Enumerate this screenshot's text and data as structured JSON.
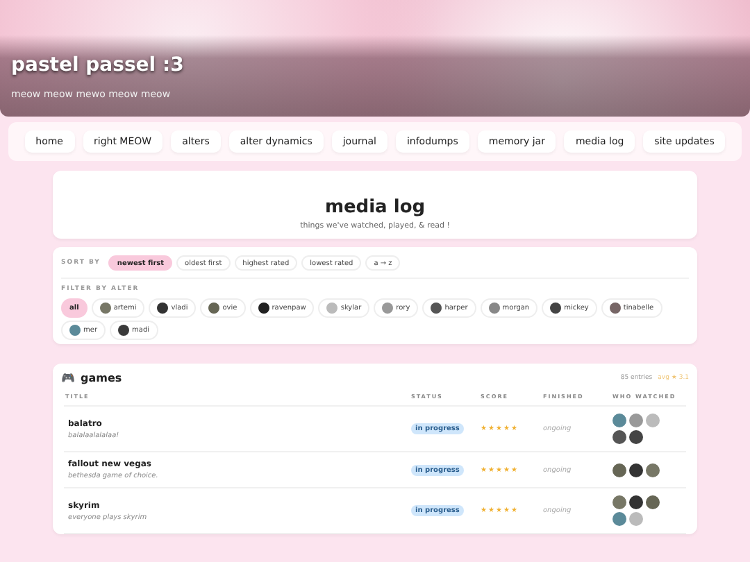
{
  "header": {
    "title": "pastel passel :3",
    "subtitle": "meow meow mewo meow meow"
  },
  "nav": [
    {
      "label": "home",
      "selected": false
    },
    {
      "label": "right MEOW",
      "selected": false
    },
    {
      "label": "alters",
      "selected": false
    },
    {
      "label": "alter dynamics",
      "selected": false
    },
    {
      "label": "journal",
      "selected": false
    },
    {
      "label": "infodumps",
      "selected": false
    },
    {
      "label": "memory jar",
      "selected": false
    },
    {
      "label": "media log",
      "selected": false
    },
    {
      "label": "site updates",
      "selected": false
    }
  ],
  "page": {
    "title": "media log",
    "subtitle": "things we've watched, played, & read !"
  },
  "sort": {
    "label": "SORT BY",
    "options": [
      {
        "label": "newest first",
        "selected": true
      },
      {
        "label": "oldest first",
        "selected": false
      },
      {
        "label": "highest rated",
        "selected": false
      },
      {
        "label": "lowest rated",
        "selected": false
      },
      {
        "label": "a → z",
        "selected": false
      }
    ]
  },
  "filter": {
    "label": "FILTER BY ALTER",
    "options": [
      {
        "label": "all",
        "selected": true,
        "kind": "plain"
      },
      {
        "label": "artemi",
        "selected": false,
        "kind": "avatar",
        "color": "#777766"
      },
      {
        "label": "vladi",
        "selected": false,
        "kind": "avatar",
        "color": "#333333"
      },
      {
        "label": "ovie",
        "selected": false,
        "kind": "avatar",
        "color": "#666655"
      },
      {
        "label": "ravenpaw",
        "selected": false,
        "kind": "avatar",
        "color": "#222222"
      },
      {
        "label": "skylar",
        "selected": false,
        "kind": "avatar",
        "color": "#bbbbbb"
      },
      {
        "label": "rory",
        "selected": false,
        "kind": "avatar",
        "color": "#999999"
      },
      {
        "label": "harper",
        "selected": false,
        "kind": "avatar",
        "color": "#555555"
      },
      {
        "label": "morgan",
        "selected": false,
        "kind": "avatar",
        "color": "#888888"
      },
      {
        "label": "mickey",
        "selected": false,
        "kind": "avatar",
        "color": "#444444"
      },
      {
        "label": "tinabelle",
        "selected": false,
        "kind": "avatar",
        "color": "#776666"
      },
      {
        "label": "mer",
        "selected": false,
        "kind": "avatar",
        "color": "#5b8a99"
      },
      {
        "label": "madi",
        "selected": false,
        "kind": "avatar",
        "color": "#3a3a3a"
      }
    ]
  },
  "section": {
    "icon": "🎮",
    "title": "games",
    "count": "85 entries",
    "average": "avg ★ 3.1",
    "columns": [
      "TITLE",
      "STATUS",
      "SCORE",
      "FINISHED",
      "WHO WATCHED"
    ],
    "rows": [
      {
        "title": "balatro",
        "note": "balalaalalalaa!",
        "status": "in progress",
        "stars": 5,
        "finished": "ongoing",
        "watchers": [
          {
            "color": "#5b8a99"
          },
          {
            "color": "#999999"
          },
          {
            "color": "#bbbbbb"
          },
          {
            "color": "#555555"
          },
          {
            "color": "#444444"
          }
        ]
      },
      {
        "title": "fallout new vegas",
        "note": "bethesda game of choice.",
        "status": "in progress",
        "stars": 5,
        "finished": "ongoing",
        "watchers": [
          {
            "color": "#666655"
          },
          {
            "color": "#333333"
          },
          {
            "color": "#777766"
          }
        ]
      },
      {
        "title": "skyrim",
        "note": "everyone plays skyrim",
        "status": "in progress",
        "stars": 5,
        "finished": "ongoing",
        "watchers": [
          {
            "color": "#777766"
          },
          {
            "color": "#333333"
          },
          {
            "color": "#666655"
          },
          {
            "color": "#5b8a99"
          },
          {
            "color": "#bbbbbb"
          }
        ]
      }
    ]
  }
}
